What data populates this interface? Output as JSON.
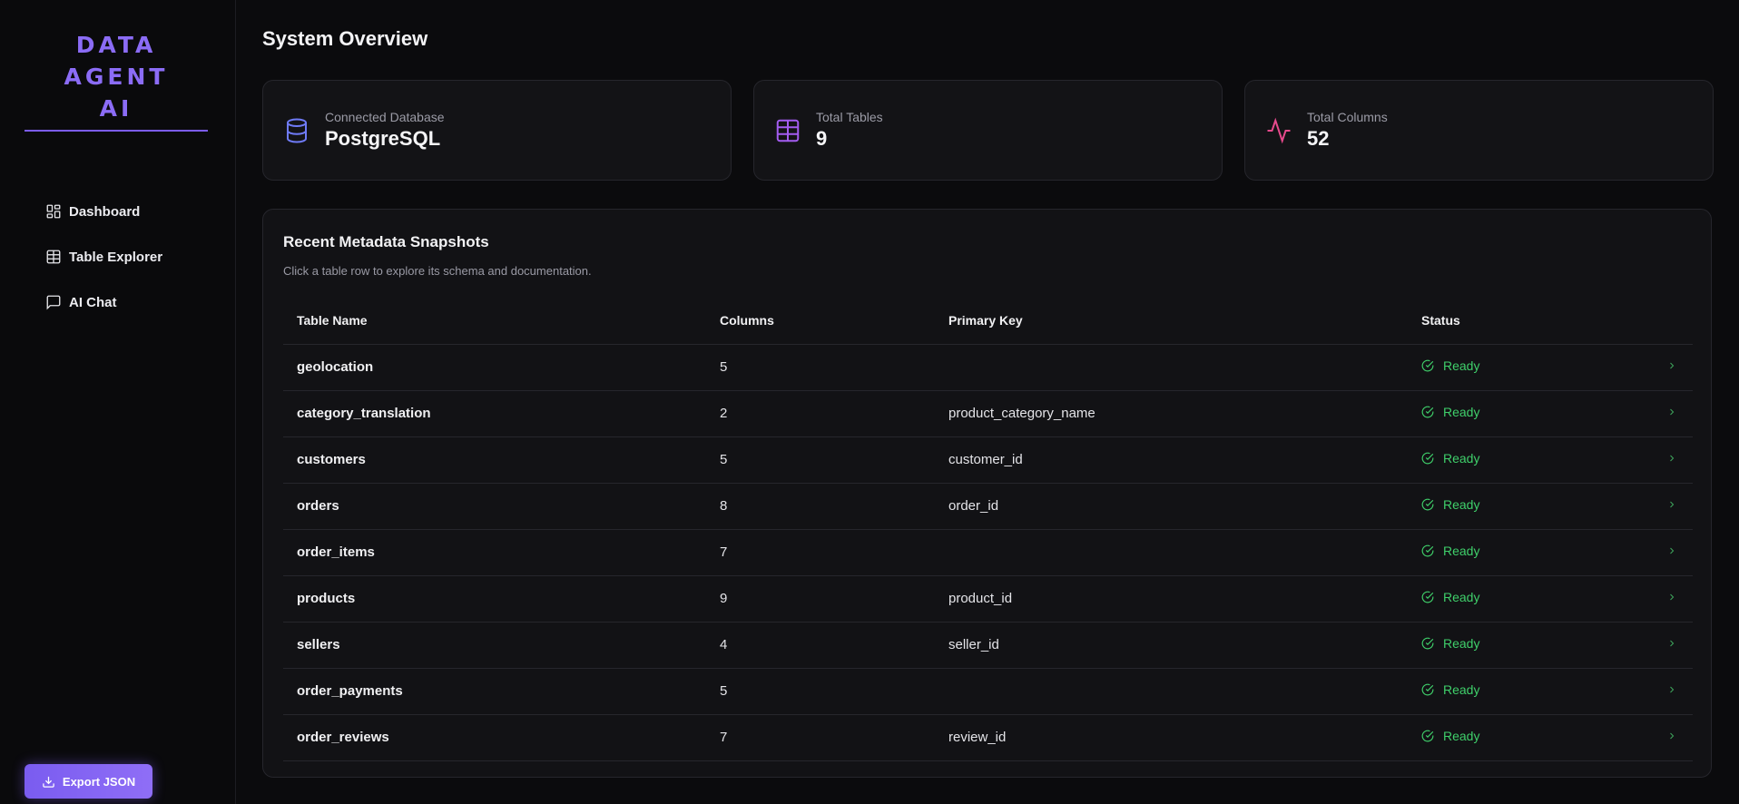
{
  "brand": {
    "line1": "DATA AGENT",
    "line2": "AI"
  },
  "nav": [
    {
      "label": "Dashboard",
      "icon": "dashboard-icon"
    },
    {
      "label": "Table Explorer",
      "icon": "table-icon"
    },
    {
      "label": "AI Chat",
      "icon": "chat-icon"
    }
  ],
  "export_button": "Export JSON",
  "page_title": "System Overview",
  "cards": [
    {
      "label": "Connected Database",
      "value": "PostgreSQL",
      "icon": "database-icon",
      "color": "#6f7bf7"
    },
    {
      "label": "Total Tables",
      "value": "9",
      "icon": "grid-table-icon",
      "color": "#a35cf0"
    },
    {
      "label": "Total Columns",
      "value": "52",
      "icon": "activity-icon",
      "color": "#e64a8c"
    }
  ],
  "panel": {
    "title": "Recent Metadata Snapshots",
    "subtitle": "Click a table row to explore its schema and documentation."
  },
  "table": {
    "headers": [
      "Table Name",
      "Columns",
      "Primary Key",
      "Status"
    ],
    "rows": [
      {
        "name": "geolocation",
        "columns": "5",
        "pk": "",
        "status": "Ready"
      },
      {
        "name": "category_translation",
        "columns": "2",
        "pk": "product_category_name",
        "status": "Ready"
      },
      {
        "name": "customers",
        "columns": "5",
        "pk": "customer_id",
        "status": "Ready"
      },
      {
        "name": "orders",
        "columns": "8",
        "pk": "order_id",
        "status": "Ready"
      },
      {
        "name": "order_items",
        "columns": "7",
        "pk": "",
        "status": "Ready"
      },
      {
        "name": "products",
        "columns": "9",
        "pk": "product_id",
        "status": "Ready"
      },
      {
        "name": "sellers",
        "columns": "4",
        "pk": "seller_id",
        "status": "Ready"
      },
      {
        "name": "order_payments",
        "columns": "5",
        "pk": "",
        "status": "Ready"
      },
      {
        "name": "order_reviews",
        "columns": "7",
        "pk": "review_id",
        "status": "Ready"
      }
    ]
  },
  "colors": {
    "accent": "#8b6cf6",
    "status_ready": "#3fcf6a",
    "background": "#0b0b0d"
  }
}
